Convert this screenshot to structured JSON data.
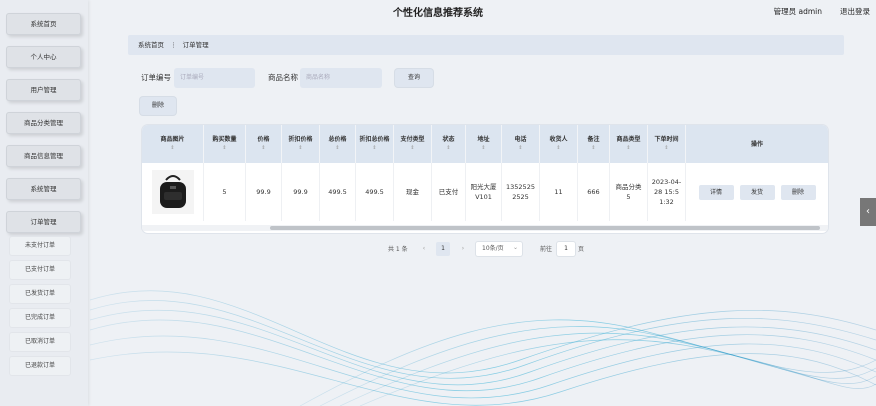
{
  "app": {
    "title": "个性化信息推荐系统",
    "user": "管理员 admin",
    "logout": "退出登录"
  },
  "sidebar": {
    "items": [
      {
        "label": "系统首页"
      },
      {
        "label": "个人中心"
      },
      {
        "label": "用户管理"
      },
      {
        "label": "商品分类管理"
      },
      {
        "label": "商品信息管理"
      },
      {
        "label": "系统管理"
      },
      {
        "label": "订单管理"
      }
    ],
    "subitems": [
      {
        "label": "未支付订单"
      },
      {
        "label": "已支付订单"
      },
      {
        "label": "已发货订单"
      },
      {
        "label": "已完成订单"
      },
      {
        "label": "已取消订单"
      },
      {
        "label": "已退款订单"
      }
    ]
  },
  "breadcrumb": {
    "home": "系统首页",
    "separator": "⋮",
    "current": "订单管理"
  },
  "search": {
    "order_no_label": "订单编号",
    "order_no_placeholder": "订单编号",
    "product_name_label": "商品名称",
    "product_name_placeholder": "商品名称",
    "query_button": "查询",
    "delete_button": "删除"
  },
  "table": {
    "headers": [
      "商品图片",
      "购买数量",
      "价格",
      "折扣价格",
      "总价格",
      "折扣总价格",
      "支付类型",
      "状态",
      "地址",
      "电话",
      "收货人",
      "备注",
      "商品类型",
      "下单时间",
      "操作"
    ],
    "sort_glyph": "⇕",
    "row": {
      "quantity": "5",
      "price": "99.9",
      "discount_price": "99.9",
      "total": "499.5",
      "discount_total": "499.5",
      "payment_type": "现金",
      "status": "已支付",
      "address": "阳光大厦V101",
      "phone": "13525252525",
      "receiver": "11",
      "remark": "666",
      "product_type": "商品分类5",
      "order_time": "2023-04-28 15:51:32",
      "actions": [
        "详情",
        "发货",
        "删除"
      ]
    }
  },
  "pagination": {
    "total": "共 1 条",
    "prev": "‹",
    "current": "1",
    "next": "›",
    "page_size": "10条/页",
    "goto_label": "前往",
    "goto_value": "1",
    "page_suffix": "页"
  },
  "icons": {
    "collapse": "‹",
    "dropdown": "⌄"
  },
  "colors": {
    "accent": "#dfe6f0",
    "header_bg": "#dce5f0",
    "sidebar_bg": "#e9ecf1",
    "wave": "#3aa7c9"
  }
}
